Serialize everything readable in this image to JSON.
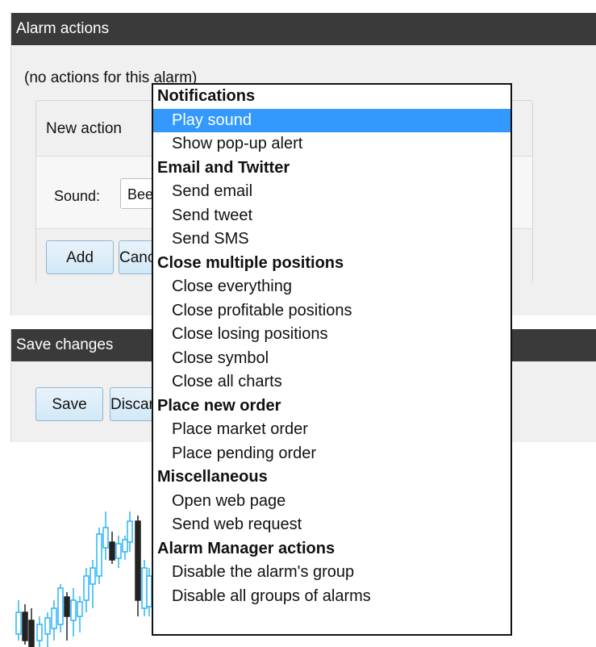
{
  "alarm_panel": {
    "title": "Alarm actions",
    "no_actions_text": "(no actions for this alarm)",
    "new_action_label": "New action",
    "sound_label": "Sound:",
    "sound_value": "Beep",
    "add_label": "Add",
    "cancel_label": "Cancel"
  },
  "save_panel": {
    "title": "Save changes",
    "save_label": "Save",
    "discard_label": "Discard"
  },
  "dropdown": {
    "groups": [
      {
        "label": "Notifications",
        "items": [
          "Play sound",
          "Show pop-up alert"
        ]
      },
      {
        "label": "Email and Twitter",
        "items": [
          "Send email",
          "Send tweet",
          "Send SMS"
        ]
      },
      {
        "label": "Close multiple positions",
        "items": [
          "Close everything",
          "Close profitable positions",
          "Close losing positions",
          "Close symbol",
          "Close all charts"
        ]
      },
      {
        "label": "Place new order",
        "items": [
          "Place market order",
          "Place pending order"
        ]
      },
      {
        "label": "Miscellaneous",
        "items": [
          "Open web page",
          "Send web request"
        ]
      },
      {
        "label": "Alarm Manager actions",
        "items": [
          "Disable the alarm's group",
          "Disable all groups of alarms"
        ]
      }
    ],
    "selected": "Play sound"
  },
  "colors": {
    "header_bg": "#3a3a3a",
    "selected_bg": "#3399ff",
    "button_border": "#8fb5d3",
    "candle_up": "#29b6f6",
    "candle_down": "#222222"
  }
}
